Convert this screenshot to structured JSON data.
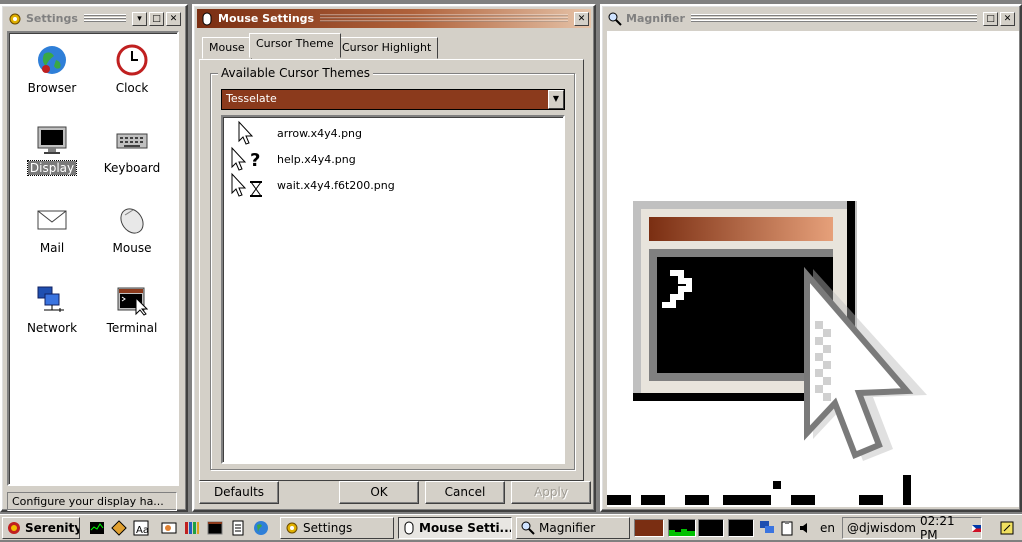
{
  "settings_window": {
    "title": "Settings",
    "apps": [
      {
        "label": "Browser",
        "icon": "browser-globe-icon"
      },
      {
        "label": "Clock",
        "icon": "clock-icon"
      },
      {
        "label": "Display",
        "icon": "monitor-icon",
        "selected": true
      },
      {
        "label": "Keyboard",
        "icon": "keyboard-icon"
      },
      {
        "label": "Mail",
        "icon": "envelope-icon"
      },
      {
        "label": "Mouse",
        "icon": "mouse-icon"
      },
      {
        "label": "Network",
        "icon": "network-icon"
      },
      {
        "label": "Terminal",
        "icon": "terminal-icon"
      }
    ],
    "status_text": "Configure your display ha..."
  },
  "mouse_settings_window": {
    "title": "Mouse Settings",
    "tabs": [
      {
        "label": "Mouse",
        "selected": false
      },
      {
        "label": "Cursor Theme",
        "selected": true
      },
      {
        "label": "Cursor Highlight",
        "selected": false
      }
    ],
    "group_label": "Available Cursor Themes",
    "selected_theme": "Tesselate",
    "cursor_files": [
      {
        "name": "arrow.x4y4.png",
        "icon": "arrow-cursor-icon"
      },
      {
        "name": "help.x4y4.png",
        "icon": "help-cursor-icon"
      },
      {
        "name": "wait.x4y4.f6t200.png",
        "icon": "wait-cursor-icon"
      }
    ],
    "buttons": {
      "defaults": "Defaults",
      "ok": "OK",
      "cancel": "Cancel",
      "apply": "Apply"
    }
  },
  "magnifier_window": {
    "title": "Magnifier"
  },
  "taskbar": {
    "start_label": "Serenity",
    "windows": [
      {
        "label": "Settings",
        "active": false
      },
      {
        "label": "Mouse Setti...",
        "active": true
      },
      {
        "label": "Magnifier",
        "active": false
      }
    ],
    "keyboard_layout": "en",
    "user": "@djwisdom",
    "time": "02:21 PM"
  },
  "colors": {
    "accent_dark": "#7a2e12",
    "accent_light": "#e6c3a8",
    "combo_selection": "#8b3a1c",
    "face": "#d4d0c8"
  }
}
